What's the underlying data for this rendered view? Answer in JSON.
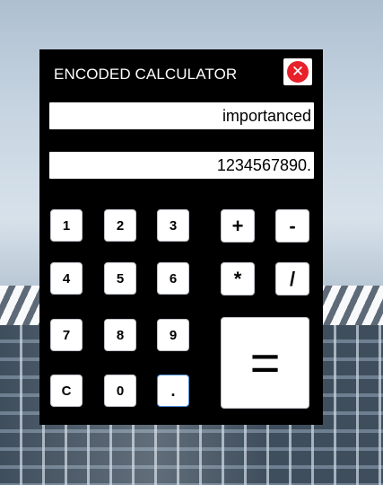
{
  "window": {
    "title": "ENCODED CALCULATOR",
    "close_glyph": "✕",
    "close_icon": "close-icon"
  },
  "displays": {
    "word": "importanced",
    "number": "1234567890."
  },
  "keys": {
    "digits": [
      "1",
      "2",
      "3",
      "4",
      "5",
      "6",
      "7",
      "8",
      "9",
      "C",
      "0",
      "."
    ],
    "operators": [
      "+",
      "-",
      "*",
      "/"
    ],
    "equals": "="
  },
  "colors": {
    "panel": "#000000",
    "key": "#ffffff",
    "close": "#e8202a",
    "dot_key_border": "#4f8fd6"
  }
}
